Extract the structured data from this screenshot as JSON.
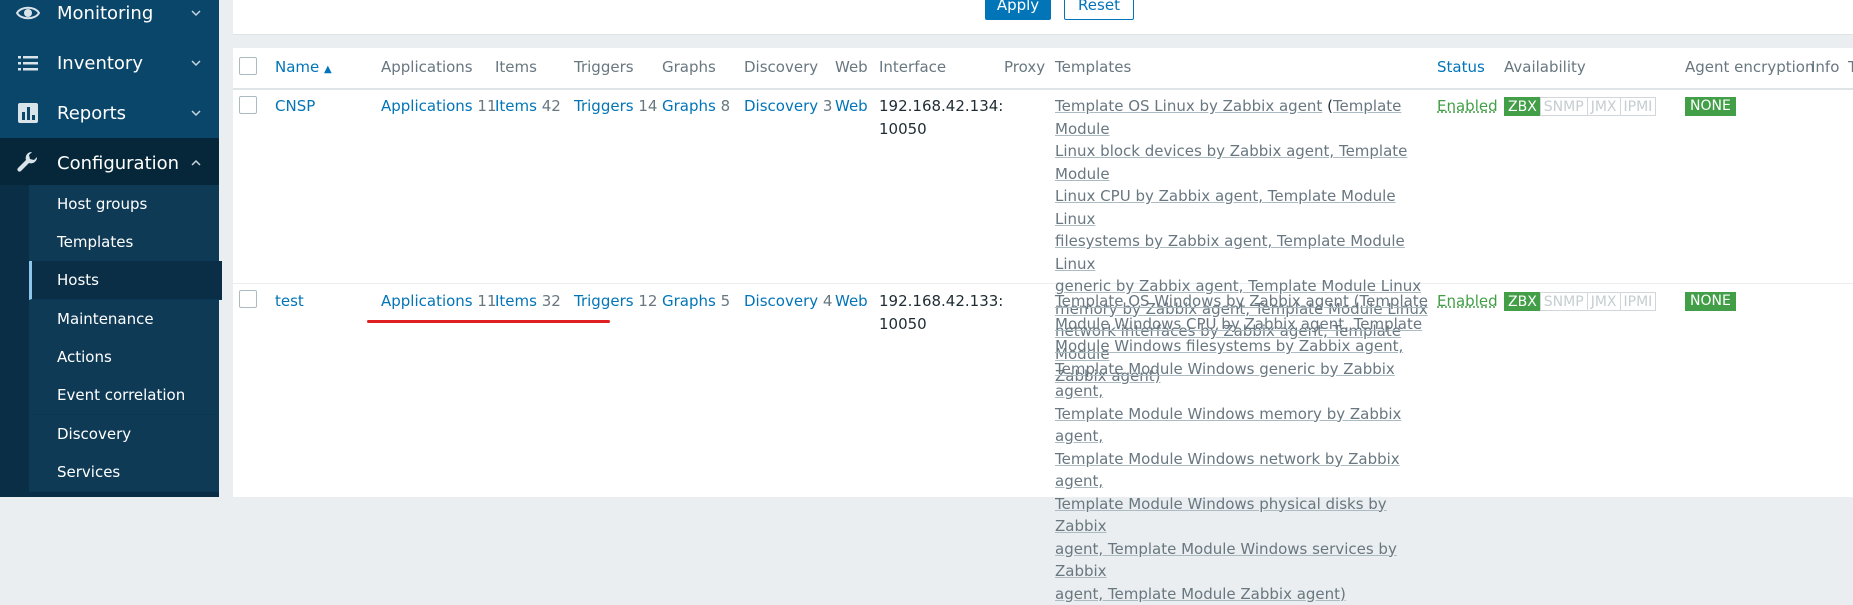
{
  "sidebar": {
    "items": [
      {
        "label": "Monitoring",
        "icon": "eye-icon"
      },
      {
        "label": "Inventory",
        "icon": "list-icon"
      },
      {
        "label": "Reports",
        "icon": "bar-chart-icon"
      },
      {
        "label": "Configuration",
        "icon": "wrench-icon"
      }
    ],
    "submenu": [
      "Host groups",
      "Templates",
      "Hosts",
      "Maintenance",
      "Actions",
      "Event correlation",
      "Discovery",
      "Services"
    ],
    "active_sub": "Hosts"
  },
  "filter": {
    "apply_label": "Apply",
    "reset_label": "Reset"
  },
  "table": {
    "headers": {
      "name": "Name",
      "applications": "Applications",
      "items": "Items",
      "triggers": "Triggers",
      "graphs": "Graphs",
      "discovery": "Discovery",
      "web": "Web",
      "interface": "Interface",
      "proxy": "Proxy",
      "templates": "Templates",
      "status": "Status",
      "availability": "Availability",
      "agent_encryption": "Agent encryption",
      "info": "Info",
      "tags": "T"
    },
    "rows": [
      {
        "name": "CNSP",
        "applications_label": "Applications",
        "applications_count": "11",
        "items_label": "Items",
        "items_count": "42",
        "triggers_label": "Triggers",
        "triggers_count": "14",
        "graphs_label": "Graphs",
        "graphs_count": "8",
        "discovery_label": "Discovery",
        "discovery_count": "3",
        "web_label": "Web",
        "interface_line1": "192.168.42.134:",
        "interface_line2": "10050",
        "templates_line1": [
          "Template OS Linux by Zabbix agent",
          " (",
          "Template Module"
        ],
        "templates_text": [
          "Linux block devices by Zabbix agent, Template Module",
          "Linux CPU by Zabbix agent, Template Module Linux",
          "filesystems by Zabbix agent, Template Module Linux",
          "generic by Zabbix agent, Template Module Linux",
          "memory by Zabbix agent, Template Module Linux",
          "network interfaces by Zabbix agent, Template Module",
          "Zabbix agent)"
        ],
        "status": "Enabled",
        "availability": [
          "ZBX",
          "SNMP",
          "JMX",
          "IPMI"
        ],
        "encryption": "NONE"
      },
      {
        "name": "test",
        "applications_label": "Applications",
        "applications_count": "11",
        "items_label": "Items",
        "items_count": "32",
        "triggers_label": "Triggers",
        "triggers_count": "12",
        "graphs_label": "Graphs",
        "graphs_count": "5",
        "discovery_label": "Discovery",
        "discovery_count": "4",
        "web_label": "Web",
        "interface_line1": "192.168.42.133:",
        "interface_line2": "10050",
        "templates_text": [
          "Template OS Windows by Zabbix agent (Template",
          "Module Windows CPU by Zabbix agent, Template",
          "Module Windows filesystems by Zabbix agent,",
          "Template Module Windows generic by Zabbix agent,",
          "Template Module Windows memory by Zabbix agent,",
          "Template Module Windows network by Zabbix agent,",
          "Template Module Windows physical disks by Zabbix",
          "agent, Template Module Windows services by Zabbix",
          "agent, Template Module Zabbix agent)"
        ],
        "status": "Enabled",
        "availability": [
          "ZBX",
          "SNMP",
          "JMX",
          "IPMI"
        ],
        "encryption": "NONE"
      }
    ]
  },
  "colors": {
    "sidebar": "#0a466a",
    "link": "#0275b8",
    "enabled": "#429e47",
    "annotation": "#e02020"
  }
}
